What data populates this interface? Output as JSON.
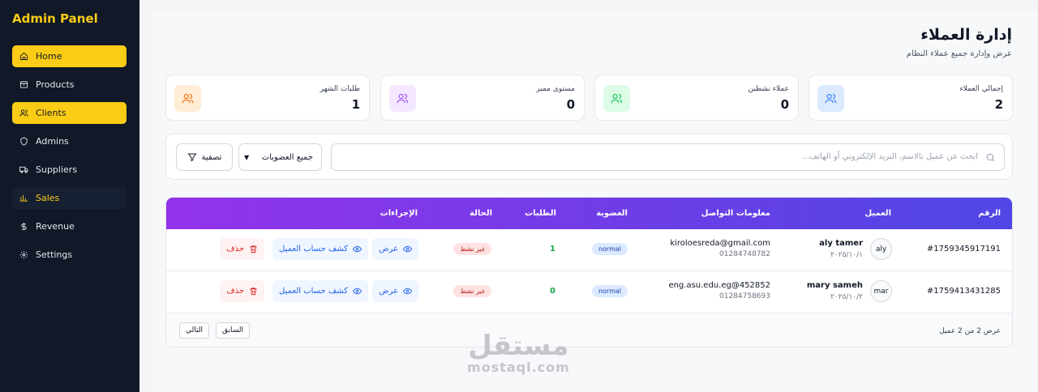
{
  "sidebar": {
    "brand": "Admin Panel",
    "items": [
      {
        "label": "Home",
        "icon": "home-icon"
      },
      {
        "label": "Products",
        "icon": "box-icon"
      },
      {
        "label": "Clients",
        "icon": "users-icon"
      },
      {
        "label": "Admins",
        "icon": "shield-icon"
      },
      {
        "label": "Suppliers",
        "icon": "truck-icon"
      },
      {
        "label": "Sales",
        "icon": "chart-icon"
      },
      {
        "label": "Revenue",
        "icon": "dollar-icon"
      },
      {
        "label": "Settings",
        "icon": "gear-icon"
      }
    ]
  },
  "header": {
    "title": "إدارة العملاء",
    "subtitle": "عرض وإدارة جميع عملاء النظام"
  },
  "stats": [
    {
      "label": "إجمالي العملاء",
      "value": "2",
      "color": "#3b82f6"
    },
    {
      "label": "عملاء نشطين",
      "value": "0",
      "color": "#22c55e"
    },
    {
      "label": "مستوى مميز",
      "value": "0",
      "color": "#a855f7"
    },
    {
      "label": "طلبات الشهر",
      "value": "1",
      "color": "#f97316"
    }
  ],
  "filters": {
    "search_placeholder": "ابحث عن عميل بالاسم، البريد الإلكتروني أو الهاتف...",
    "membership_selected": "جميع العضويات",
    "filter_label": "تصفية"
  },
  "table": {
    "columns": [
      "الرقم",
      "العميل",
      "معلومات التواصل",
      "العضوية",
      "الطلبات",
      "الحالة",
      "الإجراءات"
    ],
    "rows": [
      {
        "id": "#1759345917191",
        "name": "aly tamer",
        "date": "٢٠٢٥/١٠/١",
        "avatar": "aly",
        "email": "kiroloesreda@gmail.com",
        "phone": "01284748782",
        "membership": "normal",
        "orders": "1",
        "status": "غير نشط"
      },
      {
        "id": "#1759413431285",
        "name": "mary sameh",
        "date": "٢٠٢٥/١٠/٢",
        "avatar": "mar",
        "email": "eng.asu.edu.eg@452852",
        "phone": "01284758693",
        "membership": "normal",
        "orders": "0",
        "status": "غير نشط"
      }
    ],
    "actions": {
      "view": "عرض",
      "statement": "كشف حساب العميل",
      "delete": "حذف"
    }
  },
  "pagination": {
    "count_text": "عرض 2 من 2 عميل",
    "prev": "السابق",
    "next": "التالي"
  },
  "watermark": {
    "arabic": "مستقل",
    "latin": "mostaql.com"
  },
  "colors": {
    "accent": "#facc15",
    "sidebar": "#111827",
    "header_from": "#9333ea",
    "header_to": "#4f46e5"
  }
}
